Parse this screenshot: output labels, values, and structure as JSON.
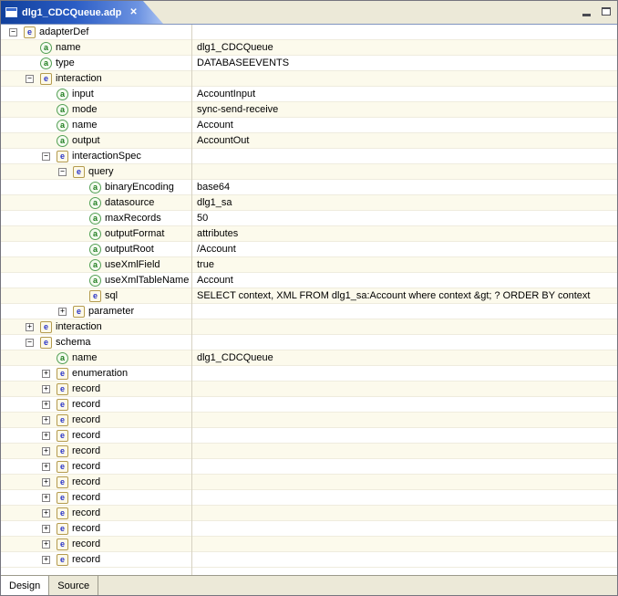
{
  "window": {
    "tab_title": "dlg1_CDCQueue.adp",
    "close_glyph": "✕"
  },
  "bottom_tabs": [
    {
      "label": "Design",
      "active": true
    },
    {
      "label": "Source",
      "active": false
    }
  ],
  "icons": {
    "element_letter": "e",
    "attribute_letter": "a"
  },
  "expand_glyphs": {
    "plus": "+",
    "minus": "−"
  },
  "colors": {
    "active_tab_gradient_start": "#11409c",
    "active_tab_gradient_end": "#a9c2f2",
    "tab_bar_bg": "#ece9d8",
    "row_alt_bg": "#fcfaec",
    "grid_line": "#efecde",
    "column_divider": "#d6d2c2",
    "element_icon_border": "#b49b4e",
    "element_icon_letter": "#2b35c8",
    "attribute_icon_border": "#55a055",
    "attribute_icon_letter": "#1f7d1f"
  },
  "tree": {
    "rows": [
      {
        "level": 0,
        "expand": "minus",
        "icon": "element",
        "label": "adapterDef",
        "value": ""
      },
      {
        "level": 1,
        "expand": "none",
        "icon": "attribute",
        "label": "name",
        "value": "dlg1_CDCQueue"
      },
      {
        "level": 1,
        "expand": "none",
        "icon": "attribute",
        "label": "type",
        "value": "DATABASEEVENTS"
      },
      {
        "level": 1,
        "expand": "minus",
        "icon": "element",
        "label": "interaction",
        "value": ""
      },
      {
        "level": 2,
        "expand": "none",
        "icon": "attribute",
        "label": "input",
        "value": "AccountInput"
      },
      {
        "level": 2,
        "expand": "none",
        "icon": "attribute",
        "label": "mode",
        "value": "sync-send-receive"
      },
      {
        "level": 2,
        "expand": "none",
        "icon": "attribute",
        "label": "name",
        "value": "Account"
      },
      {
        "level": 2,
        "expand": "none",
        "icon": "attribute",
        "label": "output",
        "value": "AccountOut"
      },
      {
        "level": 2,
        "expand": "minus",
        "icon": "element",
        "label": "interactionSpec",
        "value": ""
      },
      {
        "level": 3,
        "expand": "minus",
        "icon": "element",
        "label": "query",
        "value": ""
      },
      {
        "level": 4,
        "expand": "none",
        "icon": "attribute",
        "label": "binaryEncoding",
        "value": "base64"
      },
      {
        "level": 4,
        "expand": "none",
        "icon": "attribute",
        "label": "datasource",
        "value": "dlg1_sa"
      },
      {
        "level": 4,
        "expand": "none",
        "icon": "attribute",
        "label": "maxRecords",
        "value": "50"
      },
      {
        "level": 4,
        "expand": "none",
        "icon": "attribute",
        "label": "outputFormat",
        "value": "attributes"
      },
      {
        "level": 4,
        "expand": "none",
        "icon": "attribute",
        "label": "outputRoot",
        "value": "/Account"
      },
      {
        "level": 4,
        "expand": "none",
        "icon": "attribute",
        "label": "useXmlField",
        "value": "true"
      },
      {
        "level": 4,
        "expand": "none",
        "icon": "attribute",
        "label": "useXmlTableName",
        "value": "Account"
      },
      {
        "level": 4,
        "expand": "none",
        "icon": "element",
        "label": "sql",
        "value": "SELECT context, XML FROM dlg1_sa:Account where context &gt; ? ORDER BY context"
      },
      {
        "level": 3,
        "expand": "plus",
        "icon": "element",
        "label": "parameter",
        "value": ""
      },
      {
        "level": 1,
        "expand": "plus",
        "icon": "element",
        "label": "interaction",
        "value": ""
      },
      {
        "level": 1,
        "expand": "minus",
        "icon": "element",
        "label": "schema",
        "value": ""
      },
      {
        "level": 2,
        "expand": "none",
        "icon": "attribute",
        "label": "name",
        "value": "dlg1_CDCQueue"
      },
      {
        "level": 2,
        "expand": "plus",
        "icon": "element",
        "label": "enumeration",
        "value": ""
      },
      {
        "level": 2,
        "expand": "plus",
        "icon": "element",
        "label": "record",
        "value": ""
      },
      {
        "level": 2,
        "expand": "plus",
        "icon": "element",
        "label": "record",
        "value": ""
      },
      {
        "level": 2,
        "expand": "plus",
        "icon": "element",
        "label": "record",
        "value": ""
      },
      {
        "level": 2,
        "expand": "plus",
        "icon": "element",
        "label": "record",
        "value": ""
      },
      {
        "level": 2,
        "expand": "plus",
        "icon": "element",
        "label": "record",
        "value": ""
      },
      {
        "level": 2,
        "expand": "plus",
        "icon": "element",
        "label": "record",
        "value": ""
      },
      {
        "level": 2,
        "expand": "plus",
        "icon": "element",
        "label": "record",
        "value": ""
      },
      {
        "level": 2,
        "expand": "plus",
        "icon": "element",
        "label": "record",
        "value": ""
      },
      {
        "level": 2,
        "expand": "plus",
        "icon": "element",
        "label": "record",
        "value": ""
      },
      {
        "level": 2,
        "expand": "plus",
        "icon": "element",
        "label": "record",
        "value": ""
      },
      {
        "level": 2,
        "expand": "plus",
        "icon": "element",
        "label": "record",
        "value": ""
      },
      {
        "level": 2,
        "expand": "plus",
        "icon": "element",
        "label": "record",
        "value": ""
      }
    ]
  }
}
